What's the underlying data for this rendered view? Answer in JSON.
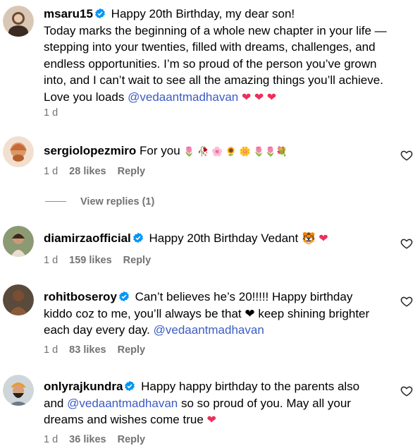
{
  "comments": [
    {
      "username": "msaru15",
      "verified": true,
      "text_lines": [
        "Happy 20th Birthday, my dear son!",
        "Today marks the beginning of a whole new chapter in your life —",
        "stepping into your twenties, filled with dreams, challenges, and",
        "endless opportunities. I’m so proud of the person you’ve grown",
        "into, and I can’t wait to see all the amazing things you’ll achieve.",
        "Love you loads"
      ],
      "mention": "@vedaantmadhavan",
      "trailing": "❤ ❤ ❤",
      "time": "1 d"
    },
    {
      "username": "sergiolopezmiro",
      "verified": false,
      "text": "For you",
      "trailing": "🌷 🥀 🌸 🌻 🌼 🌷🌷💐",
      "time": "1 d",
      "likes": "28 likes",
      "reply": "Reply"
    },
    {
      "username": "diamirzaofficial",
      "verified": true,
      "text": "Happy 20th Birthday Vedant",
      "trailing": "🐯 ❤",
      "time": "1 d",
      "likes": "159 likes",
      "reply": "Reply"
    },
    {
      "username": "rohitboseroy",
      "verified": true,
      "text_lines": [
        "Can’t believes he’s 20!!!!! Happy birthday",
        "kiddo coz to me, you’ll always be that ❤  keep shining brighter",
        "each day every day."
      ],
      "mention": "@vedaantmadhavan",
      "time": "1 d",
      "likes": "83 likes",
      "reply": "Reply"
    },
    {
      "username": "onlyrajkundra",
      "verified": true,
      "text_lines": [
        "Happy happy birthday to the parents also",
        "and",
        "so so proud of you. May all your",
        "dreams and wishes come true"
      ],
      "mention": "@vedaantmadhavan",
      "trailing": "❤",
      "time": "1 d",
      "likes": "36 likes",
      "reply": "Reply"
    }
  ],
  "view_replies": "View replies (1)",
  "colors": {
    "mention": "#3b5bc4",
    "meta": "#737373",
    "heart": "#ed2e5a",
    "verified": "#0095f6"
  }
}
